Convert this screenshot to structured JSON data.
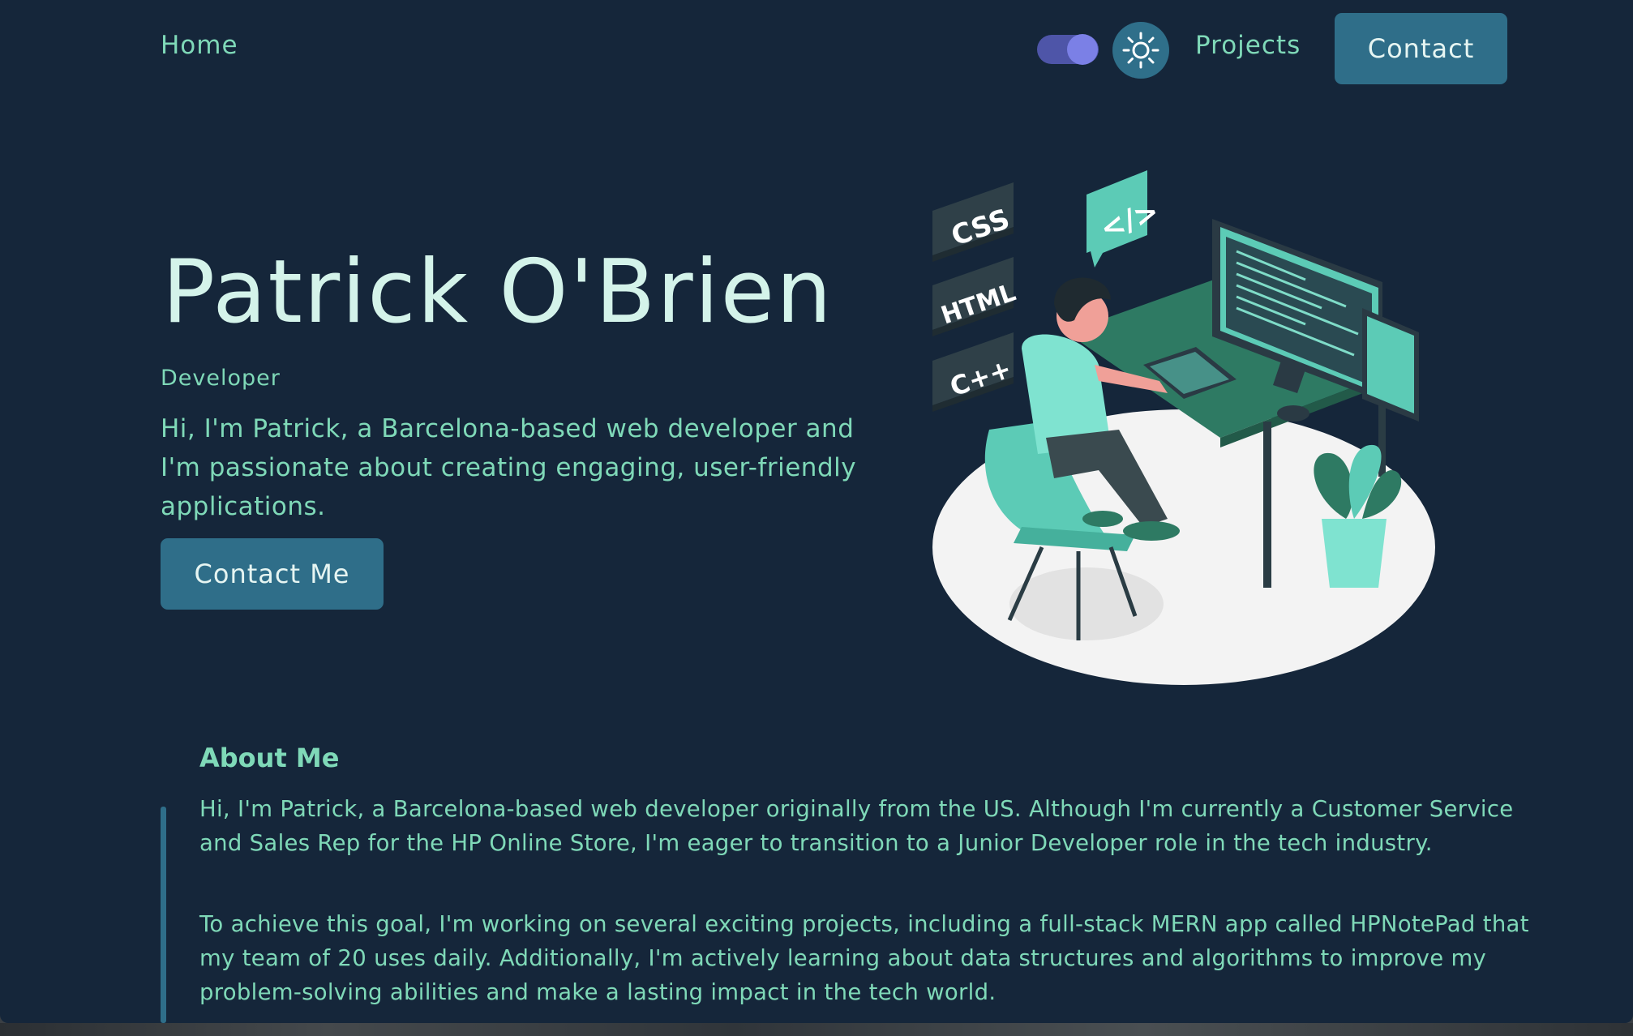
{
  "nav": {
    "home": "Home",
    "projects": "Projects",
    "contact": "Contact"
  },
  "hero": {
    "name": "Patrick O'Brien",
    "role": "Developer",
    "intro": "Hi, I'm Patrick, a Barcelona-based web developer and I'm passionate about creating engaging, user-friendly applications.",
    "cta": "Contact Me"
  },
  "illustration": {
    "badges": [
      "CSS",
      "HTML",
      "C++"
    ],
    "code_tag": "</>"
  },
  "about": {
    "title": "About Me",
    "paragraphs": [
      "Hi, I'm Patrick, a Barcelona-based web developer originally from the US. Although I'm currently a Customer Service and Sales Rep for the HP Online Store, I'm eager to transition to a Junior Developer role in the tech industry.",
      "To achieve this goal, I'm working on several exciting projects, including a full-stack MERN app called HPNotePad that my team of 20 uses daily. Additionally, I'm actively learning about data structures and algorithms to improve my problem-solving abilities and make a lasting impact in the tech world."
    ]
  },
  "icons": {
    "theme_toggle": "theme-toggle-switch",
    "sun": "sun-icon"
  },
  "colors": {
    "background": "#15263a",
    "accent_text": "#7fd9b8",
    "heading_text": "#d4f3ea",
    "button": "#2f6e89",
    "toggle": "#4e55a8",
    "toggle_knob": "#7b80e6"
  }
}
